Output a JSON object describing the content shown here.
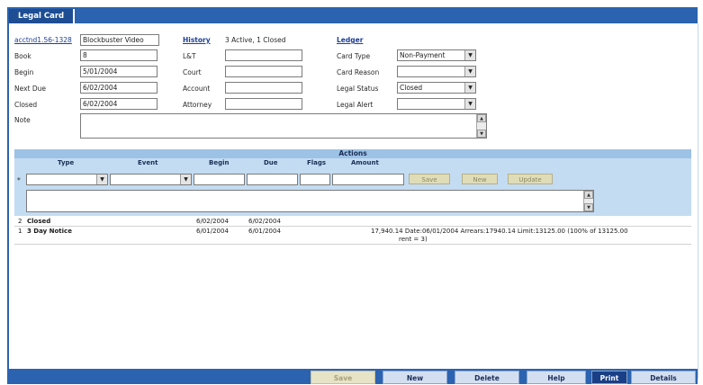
{
  "tab": {
    "label": "Legal Card"
  },
  "header": {
    "account_link": "acctnd1.56-1328",
    "account_name": "Blockbuster Video",
    "history_link": "History",
    "history_status": "3 Active, 1 Closed",
    "ledger_link": "Ledger"
  },
  "left_fields": [
    {
      "label": "Book",
      "value": "8"
    },
    {
      "label": "Begin",
      "value": "5/01/2004"
    },
    {
      "label": "Next Due",
      "value": "6/02/2004"
    },
    {
      "label": "Closed",
      "value": "6/02/2004"
    }
  ],
  "mid_fields": [
    {
      "label": "L&T",
      "value": ""
    },
    {
      "label": "Court",
      "value": ""
    },
    {
      "label": "Account",
      "value": ""
    },
    {
      "label": "Attorney",
      "value": ""
    }
  ],
  "right_fields": [
    {
      "label": "Card Type",
      "value": "Non-Payment"
    },
    {
      "label": "Card Reason",
      "value": ""
    },
    {
      "label": "Legal Status",
      "value": "Closed"
    },
    {
      "label": "Legal Alert",
      "value": ""
    }
  ],
  "note": {
    "label": "Note",
    "value": ""
  },
  "actions": {
    "title": "Actions",
    "columns": [
      "Type",
      "Event",
      "Begin",
      "Due",
      "Flags",
      "Amount"
    ],
    "entry_row_marker": "*",
    "buttons": {
      "save": "Save",
      "new": "New",
      "update": "Update"
    }
  },
  "rows": [
    {
      "num": "2",
      "type": "Closed",
      "begin": "6/02/2004",
      "due": "6/02/2004",
      "detail": "",
      "detail2": ""
    },
    {
      "num": "1",
      "type": "3 Day Notice",
      "begin": "6/01/2004",
      "due": "6/01/2004",
      "detail": "17,940.14  Date:06/01/2004  Arrears:17940.14  Limit:13125.00 (100% of 13125.00",
      "detail2": "rent = 3)"
    }
  ],
  "bottom_buttons": {
    "save": "Save",
    "new": "New",
    "delete": "Delete",
    "help": "Help",
    "print": "Print",
    "details": "Details"
  },
  "colors": {
    "frame_blue": "#2b63b0",
    "actions_header": "#9cc2e6",
    "actions_area": "#c3dcf2",
    "disabled_button": "#e7e3c6",
    "active_button": "#1a3f86"
  }
}
